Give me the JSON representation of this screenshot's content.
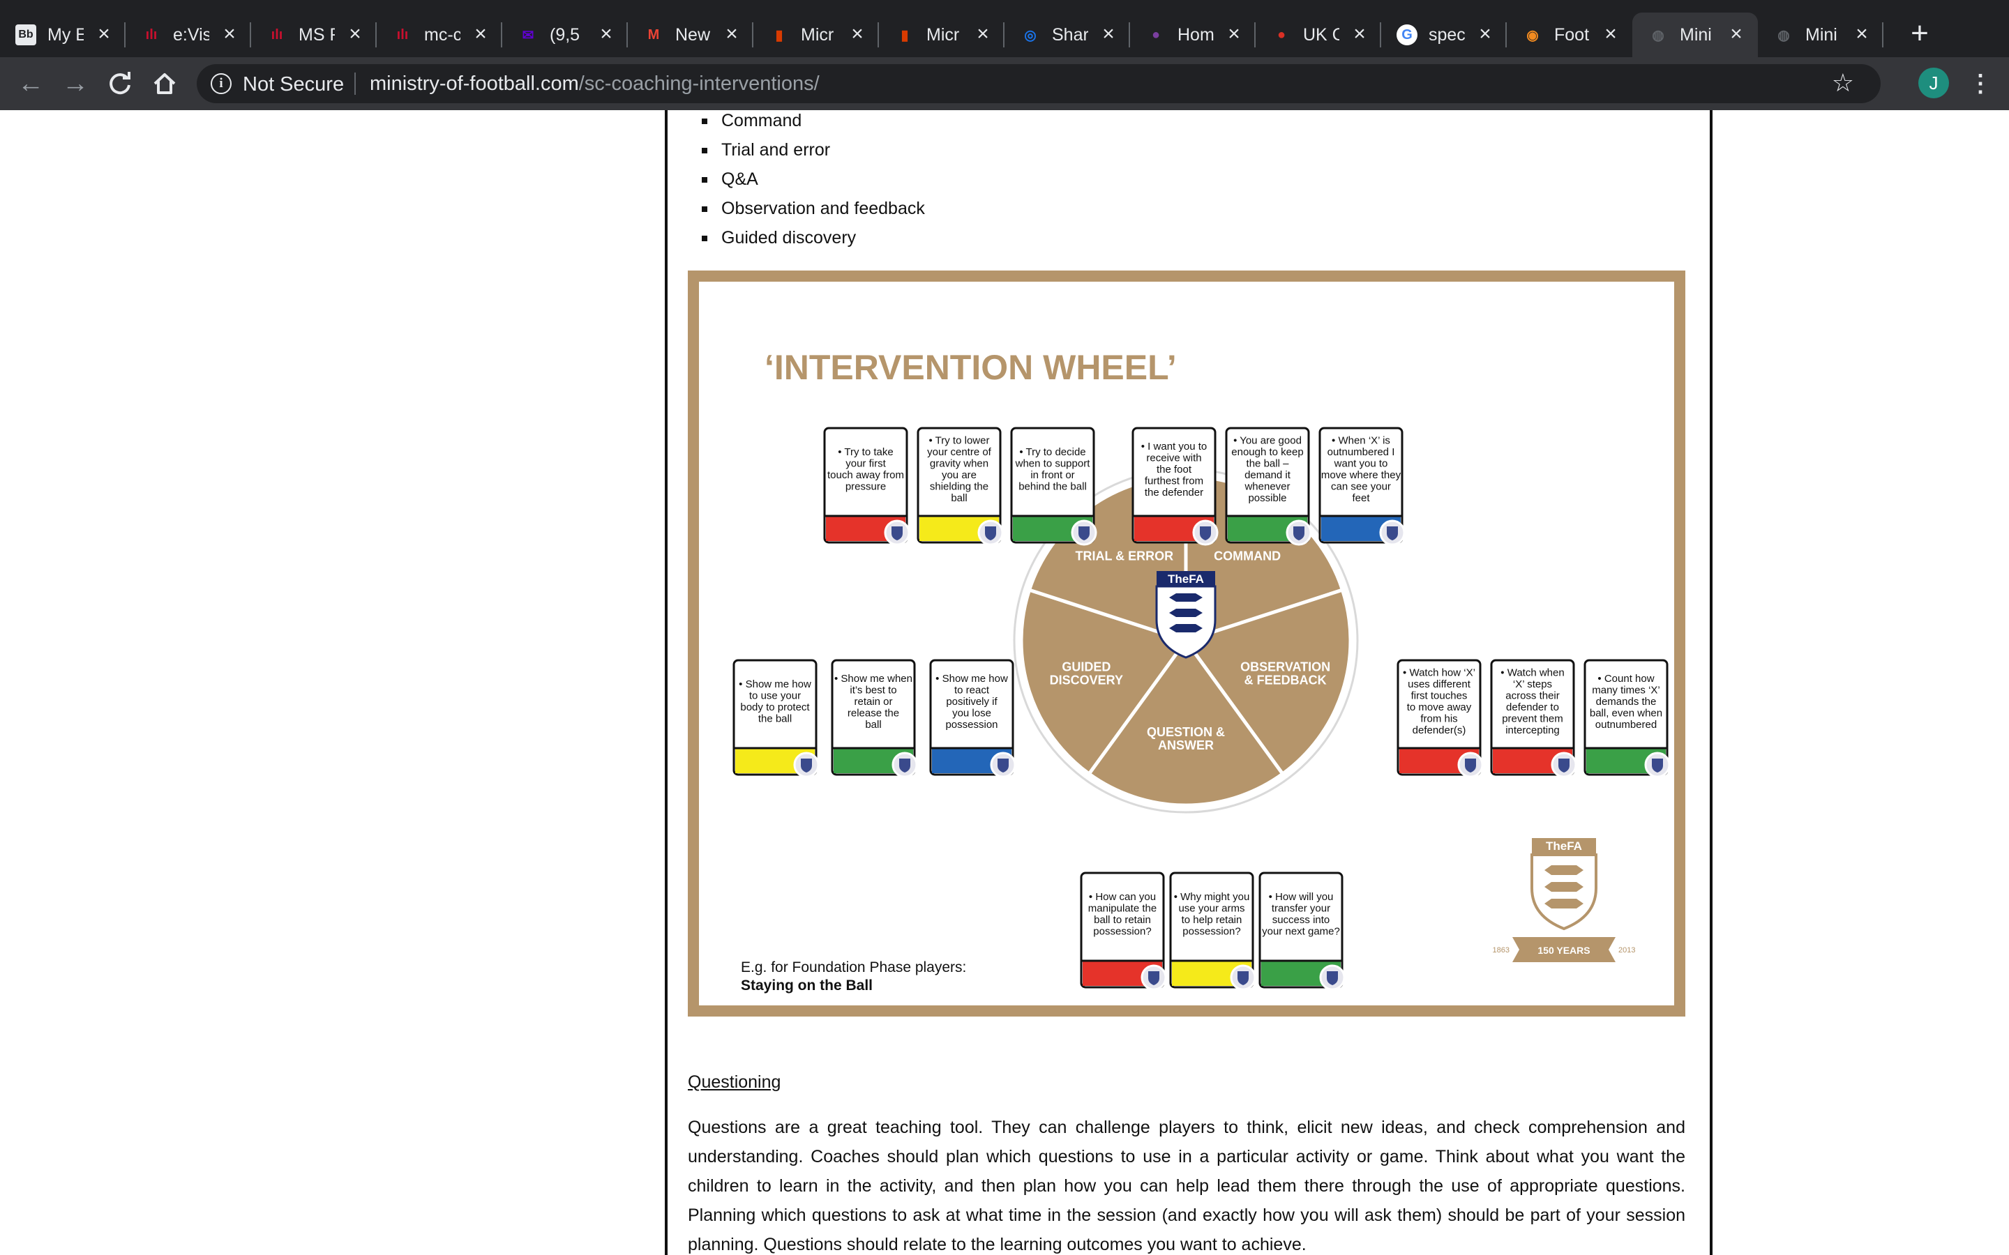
{
  "browser": {
    "tabs": [
      {
        "title": "My E",
        "icon": "blackboard-icon",
        "color": "#3a3a3a"
      },
      {
        "title": "e:Vis",
        "icon": "evision-icon",
        "color": "#c8102e"
      },
      {
        "title": "MS F",
        "icon": "evision-icon",
        "color": "#c8102e"
      },
      {
        "title": "mc-c",
        "icon": "evision-icon",
        "color": "#c8102e"
      },
      {
        "title": "(9,5",
        "icon": "yahoo-mail-icon",
        "color": "#6001d2"
      },
      {
        "title": "New",
        "icon": "gmail-icon",
        "color": "#ea4335"
      },
      {
        "title": "Micr",
        "icon": "office-icon",
        "color": "#d83b01"
      },
      {
        "title": "Micr",
        "icon": "office-icon",
        "color": "#d83b01"
      },
      {
        "title": "Shar",
        "icon": "sharepoint-icon",
        "color": "#1a73e8"
      },
      {
        "title": "Hom",
        "icon": "home-site-icon",
        "color": "#7b3fa0"
      },
      {
        "title": "UK C",
        "icon": "pin-icon",
        "color": "#d93025"
      },
      {
        "title": "spec",
        "icon": "google-icon",
        "color": "#ffffff"
      },
      {
        "title": "Foot",
        "icon": "lifebuoy-icon",
        "color": "#f28b20"
      },
      {
        "title": "Mini",
        "icon": "globe-icon",
        "color": "#5f6368"
      },
      {
        "title": "Mini",
        "icon": "globe-icon",
        "color": "#5f6368"
      }
    ],
    "active_tab_index": 13,
    "security_label": "Not Secure",
    "url_domain": "ministry-of-football.com",
    "url_path": "/sc-coaching-interventions/",
    "profile_initial": "J"
  },
  "page": {
    "methods": [
      "Command",
      "Trial and error",
      "Q&A",
      "Observation and feedback",
      "Guided discovery"
    ],
    "questioning_heading": "Questioning",
    "questioning_text": "Questions are a great teaching tool. They can challenge players to think, elicit new ideas, and check comprehension and understanding. Coaches should plan which questions to use in a particular activity or game. Think about what you want the children to learn in the activity, and then plan how you can help lead them there through the use of appropriate questions. Planning which questions to ask at what time in the session (and exactly how you will ask them) should be part of your session planning. Questions should relate to the learning outcomes you want to achieve."
  },
  "wheel": {
    "title": "‘INTERVENTION WHEEL’",
    "segments": [
      "TRIAL & ERROR",
      "COMMAND",
      "OBSERVATION & FEEDBACK",
      "QUESTION & ANSWER",
      "GUIDED DISCOVERY"
    ],
    "badge_text": "TheFA",
    "footer_caption": "E.g. for Foundation Phase players:",
    "footer_caption_bold": "Staying on the Ball",
    "logo_text": "TheFA",
    "logo_years": "150 YEARS",
    "logo_year_start": "1863",
    "logo_year_end": "2013",
    "colors": {
      "gold": "#b5956b",
      "red": "#e5332a",
      "yellow": "#f5ea1a",
      "green": "#3aa047",
      "blue": "#2366b8"
    },
    "card_groups": [
      {
        "name": "trial-error",
        "cards": [
          {
            "text": "• Try to take your first touch away from pressure",
            "color": "red"
          },
          {
            "text": "• Try to lower your centre of gravity when you are shielding the ball",
            "color": "yellow"
          },
          {
            "text": "• Try to decide when to support in front or behind the ball",
            "color": "green"
          }
        ]
      },
      {
        "name": "command",
        "cards": [
          {
            "text": "• I want you to receive with the foot furthest from the defender",
            "color": "red"
          },
          {
            "text": "• You are good enough to keep the ball – demand it whenever possible",
            "color": "green"
          },
          {
            "text": "• When ‘X’ is outnumbered I want you to move where they can see your feet",
            "color": "blue"
          }
        ]
      },
      {
        "name": "guided-discovery",
        "cards": [
          {
            "text": "• Show me how to use your body to protect the ball",
            "color": "yellow"
          },
          {
            "text": "• Show me when it’s best to retain or release the ball",
            "color": "green"
          },
          {
            "text": "• Show me how to react positively if you lose possession",
            "color": "blue"
          }
        ]
      },
      {
        "name": "observation-feedback",
        "cards": [
          {
            "text": "• Watch how ‘X’ uses different first touches to move away from his defender(s)",
            "color": "red"
          },
          {
            "text": "• Watch when ‘X’ steps across their defender to prevent them intercepting",
            "color": "red"
          },
          {
            "text": "• Count how many times ‘X’ demands the ball, even when outnumbered",
            "color": "green"
          }
        ]
      },
      {
        "name": "question-answer",
        "cards": [
          {
            "text": "• How can you manipulate the ball to retain possession?",
            "color": "red"
          },
          {
            "text": "• Why might you use your arms to help retain possession?",
            "color": "yellow"
          },
          {
            "text": "• How will you transfer your success into your next game?",
            "color": "green"
          }
        ]
      }
    ]
  }
}
